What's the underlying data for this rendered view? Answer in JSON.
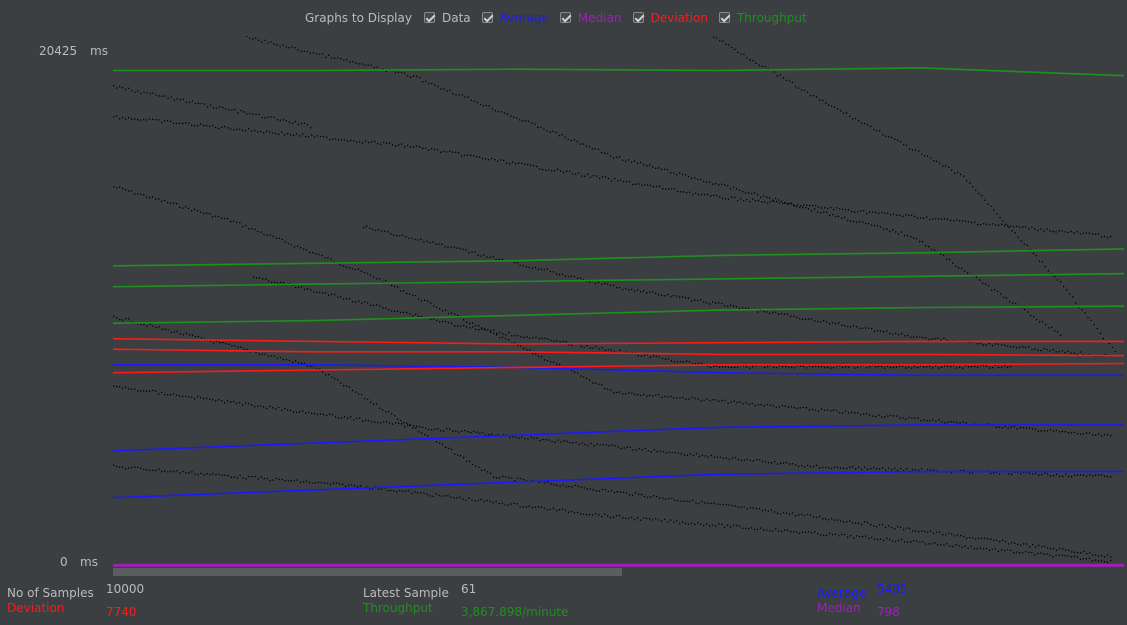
{
  "legend": {
    "caption": "Graphs to Display",
    "items": [
      {
        "label": "Data",
        "color": "#bbbbbb",
        "checked": true
      },
      {
        "label": "Average",
        "color": "#1a1aff",
        "checked": true
      },
      {
        "label": "Median",
        "color": "#9b22b4",
        "checked": true
      },
      {
        "label": "Deviation",
        "color": "#ff1a1a",
        "checked": true
      },
      {
        "label": "Throughput",
        "color": "#1f8f1f",
        "checked": true
      }
    ]
  },
  "axis": {
    "y_max_value": "20425",
    "y_max_unit": "ms",
    "y_min_value": "0",
    "y_min_unit": "ms"
  },
  "stats": {
    "samples_label": "No of Samples",
    "samples_value": "10000",
    "deviation_label": "Deviation",
    "deviation_value": "7740",
    "latest_label": "Latest Sample",
    "latest_value": "61",
    "throughput_label": "Throughput",
    "throughput_value": "3,867.898/minute",
    "average_label": "Average",
    "average_value": "5495",
    "median_label": "Median",
    "median_value": "798"
  },
  "colors": {
    "background": "#3c3f41",
    "data": "#000000",
    "average": "#1a1aff",
    "median": "#9b22b4",
    "deviation": "#ff1a1a",
    "throughput": "#1f8f1f",
    "label": "#bbbbbb"
  },
  "chart_data": {
    "type": "line",
    "ylim": [
      0,
      20425
    ],
    "y_unit": "ms",
    "series": [
      {
        "name": "Average",
        "values": [
          7800,
          7800,
          7700,
          7500,
          7400,
          7400
        ]
      },
      {
        "name": "Average",
        "values": [
          4500,
          4800,
          5100,
          5400,
          5495,
          5495
        ]
      },
      {
        "name": "Average",
        "values": [
          2700,
          3000,
          3300,
          3600,
          3700,
          3700
        ]
      },
      {
        "name": "Deviation",
        "values": [
          8800,
          8700,
          8600,
          8650,
          8700,
          8700
        ]
      },
      {
        "name": "Deviation",
        "values": [
          8400,
          8300,
          8300,
          8200,
          8200,
          8150
        ]
      },
      {
        "name": "Deviation",
        "values": [
          7500,
          7600,
          7700,
          7800,
          7800,
          7850
        ]
      },
      {
        "name": "Throughput",
        "values": [
          11600,
          11700,
          11800,
          12000,
          12100,
          12250
        ]
      },
      {
        "name": "Throughput",
        "values": [
          10800,
          10900,
          11000,
          11100,
          11200,
          11300
        ]
      },
      {
        "name": "Throughput",
        "values": [
          9400,
          9500,
          9700,
          9900,
          10000,
          10050
        ]
      },
      {
        "name": "Throughput",
        "values": [
          19100,
          19100,
          19150,
          19100,
          19200,
          18900
        ]
      },
      {
        "name": "Median",
        "values": [
          100,
          100,
          100,
          100,
          100,
          100
        ]
      }
    ]
  }
}
